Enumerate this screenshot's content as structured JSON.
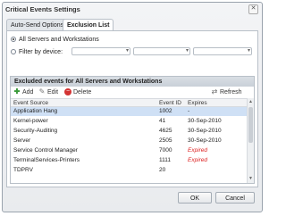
{
  "dialog": {
    "title": "Critical Events Settings",
    "close_glyph": "✕"
  },
  "tabs": [
    {
      "label": "Auto-Send Options",
      "active": false
    },
    {
      "label": "Exclusion List",
      "active": true
    }
  ],
  "options": {
    "all_servers_label": "All Servers and Workstations",
    "filter_label": "Filter by device:",
    "selected": "all"
  },
  "grid": {
    "title": "Excluded events for All Servers and Workstations",
    "toolbar": {
      "add": "Add",
      "edit": "Edit",
      "delete": "Delete",
      "refresh": "Refresh"
    },
    "columns": [
      "Event Source",
      "Event ID",
      "Expires"
    ],
    "rows": [
      {
        "source": "Application Hang",
        "id": "1002",
        "expires": "-",
        "expired": false,
        "selected": true
      },
      {
        "source": "Kernel-power",
        "id": "41",
        "expires": "30-Sep-2010",
        "expired": false,
        "selected": false
      },
      {
        "source": "Security-Auditing",
        "id": "4625",
        "expires": "30-Sep-2010",
        "expired": false,
        "selected": false
      },
      {
        "source": "Server",
        "id": "2505",
        "expires": "30-Sep-2010",
        "expired": false,
        "selected": false
      },
      {
        "source": "Service Control Manager",
        "id": "7000",
        "expires": "Expired",
        "expired": true,
        "selected": false
      },
      {
        "source": "TerminalServices-Printers",
        "id": "1111",
        "expires": "Expired",
        "expired": true,
        "selected": false
      },
      {
        "source": "TDPRV",
        "id": "20",
        "expires": "",
        "expired": false,
        "selected": false
      }
    ]
  },
  "footer": {
    "ok": "OK",
    "cancel": "Cancel"
  },
  "colors": {
    "selected_row": "#cfe0f5",
    "expired_text": "#dd2222",
    "add_icon": "#3a9a3a",
    "delete_icon": "#d33333"
  }
}
